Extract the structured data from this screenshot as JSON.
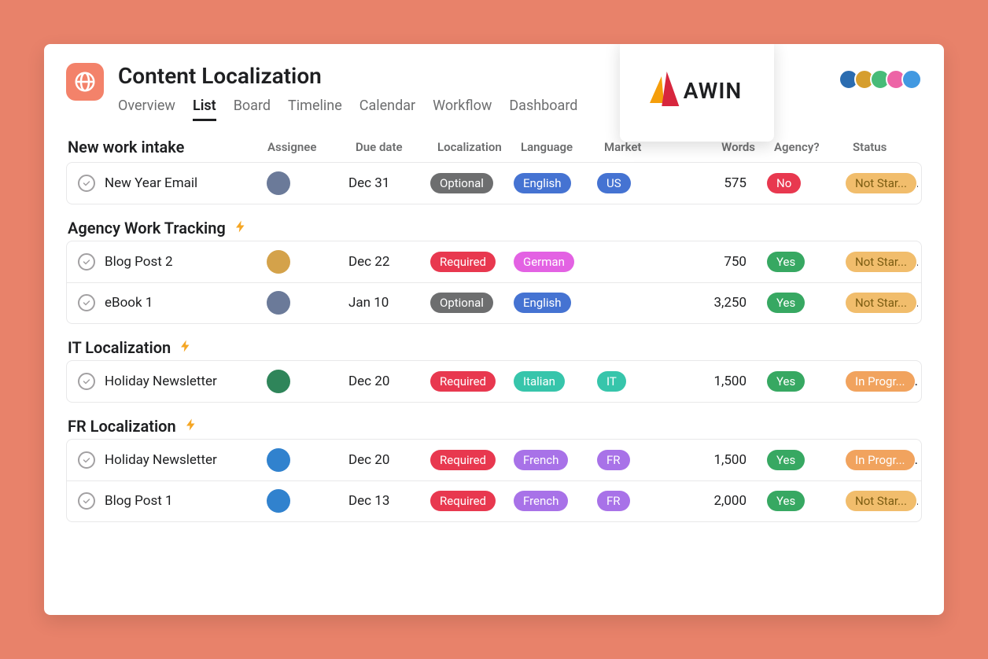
{
  "logo_name": "AWIN",
  "project": {
    "title": "Content Localization"
  },
  "tabs": [
    "Overview",
    "List",
    "Board",
    "Timeline",
    "Calendar",
    "Workflow",
    "Dashboard"
  ],
  "selected_tab_index": 1,
  "columns": {
    "assignee": "Assignee",
    "due": "Due date",
    "localization": "Localization",
    "language": "Language",
    "market": "Market",
    "words": "Words",
    "agency": "Agency?",
    "status": "Status"
  },
  "collaborator_colors": [
    "#2b6cb0",
    "#d69e2e",
    "#48bb78",
    "#ed64a6",
    "#4299e1"
  ],
  "avatar_palette": {
    "a": "#6b7a99",
    "b": "#d4a24a",
    "c": "#2f855a",
    "d": "#3182ce"
  },
  "sections": [
    {
      "name": "New work intake",
      "rule": false,
      "tasks": [
        {
          "title": "New Year Email",
          "assignee": "a",
          "due": "Dec 31",
          "loc": "Optional",
          "loc_cls": "optional",
          "lang": "English",
          "lang_cls": "english",
          "market": "US",
          "market_cls": "us",
          "words": "575",
          "agency": "No",
          "agency_cls": "no",
          "status": "Not Star...",
          "status_cls": "status-notstarted"
        }
      ]
    },
    {
      "name": "Agency Work Tracking",
      "rule": true,
      "tasks": [
        {
          "title": "Blog Post 2",
          "assignee": "b",
          "due": "Dec 22",
          "loc": "Required",
          "loc_cls": "required",
          "lang": "German",
          "lang_cls": "german",
          "market": "",
          "market_cls": "",
          "words": "750",
          "agency": "Yes",
          "agency_cls": "yes",
          "status": "Not Star...",
          "status_cls": "status-notstarted"
        },
        {
          "title": "eBook 1",
          "assignee": "a",
          "due": "Jan 10",
          "loc": "Optional",
          "loc_cls": "optional",
          "lang": "English",
          "lang_cls": "english",
          "market": "",
          "market_cls": "",
          "words": "3,250",
          "agency": "Yes",
          "agency_cls": "yes",
          "status": "Not Star...",
          "status_cls": "status-notstarted"
        }
      ]
    },
    {
      "name": "IT Localization",
      "rule": true,
      "tasks": [
        {
          "title": "Holiday Newsletter",
          "assignee": "c",
          "due": "Dec 20",
          "loc": "Required",
          "loc_cls": "required",
          "lang": "Italian",
          "lang_cls": "italian",
          "market": "IT",
          "market_cls": "it",
          "words": "1,500",
          "agency": "Yes",
          "agency_cls": "yes",
          "status": "In Progr...",
          "status_cls": "status-inprogress"
        }
      ]
    },
    {
      "name": "FR Localization",
      "rule": true,
      "tasks": [
        {
          "title": "Holiday Newsletter",
          "assignee": "d",
          "due": "Dec 20",
          "loc": "Required",
          "loc_cls": "required",
          "lang": "French",
          "lang_cls": "french",
          "market": "FR",
          "market_cls": "fr",
          "words": "1,500",
          "agency": "Yes",
          "agency_cls": "yes",
          "status": "In Progr...",
          "status_cls": "status-inprogress"
        },
        {
          "title": "Blog Post 1",
          "assignee": "d",
          "due": "Dec 13",
          "loc": "Required",
          "loc_cls": "required",
          "lang": "French",
          "lang_cls": "french",
          "market": "FR",
          "market_cls": "fr",
          "words": "2,000",
          "agency": "Yes",
          "agency_cls": "yes",
          "status": "Not Star...",
          "status_cls": "status-notstarted"
        }
      ]
    }
  ]
}
